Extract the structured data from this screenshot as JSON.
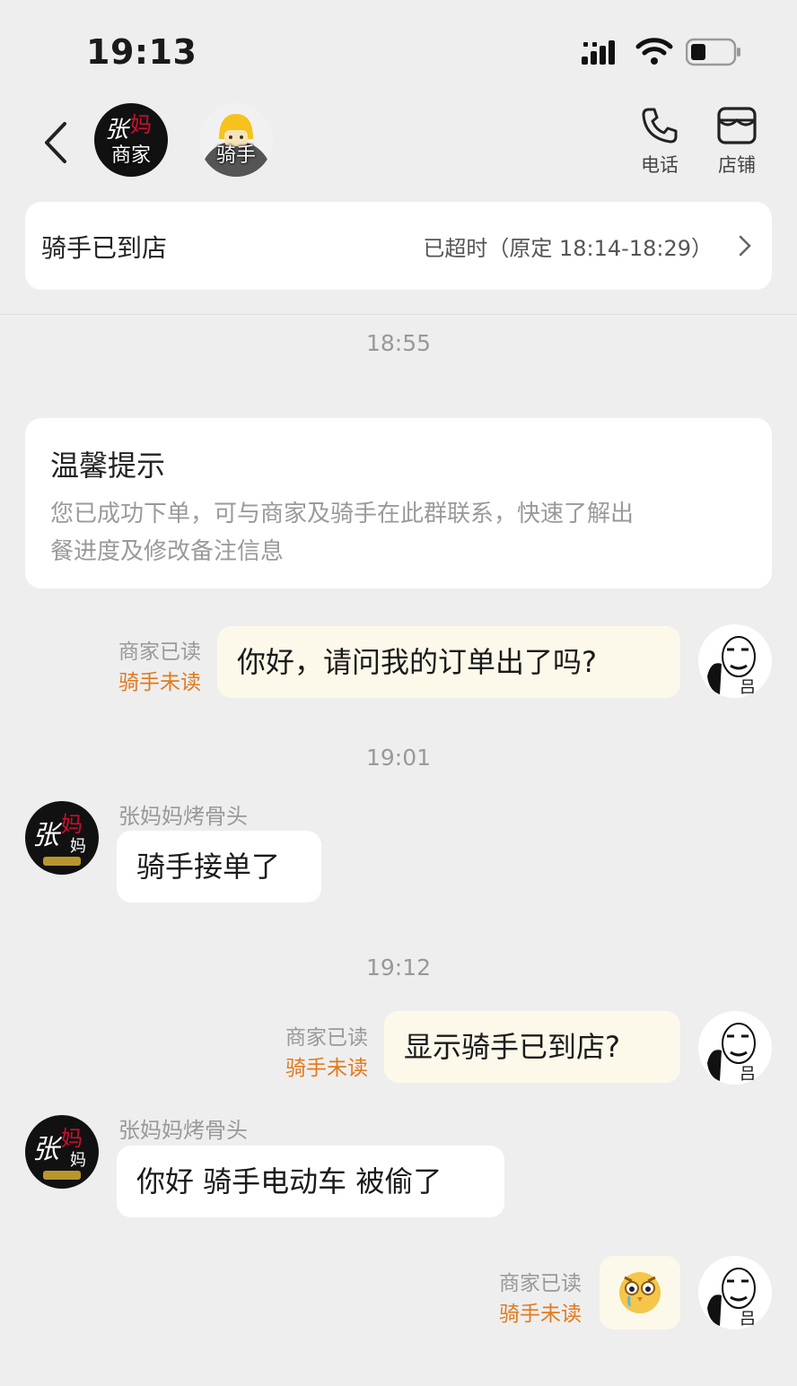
{
  "status_bar": {
    "time": "19:13"
  },
  "nav": {
    "merchant_avatar_label": "商家",
    "rider_avatar_label": "骑手",
    "actions": [
      {
        "label": "电话",
        "icon": "phone-icon"
      },
      {
        "label": "店铺",
        "icon": "store-icon"
      }
    ]
  },
  "order": {
    "title": "骑手已到店",
    "status": "已超时（原定 18:14-18:29）"
  },
  "tip": {
    "title": "温馨提示",
    "body_line1": "您已成功下单，可与商家及骑手在此群联系，快速了解出",
    "body_line2": "餐进度及修改备注信息"
  },
  "chat": {
    "timestamps": [
      "18:55",
      "19:01",
      "19:12"
    ],
    "merchant_name": "张妈妈烤骨头",
    "read_merchant": "商家已读",
    "unread_rider": "骑手未读",
    "messages": [
      {
        "from": "me",
        "text": "你好，请问我的订单出了吗?"
      },
      {
        "from": "merchant",
        "text": "骑手接单了"
      },
      {
        "from": "me",
        "text": "显示骑手已到店?"
      },
      {
        "from": "merchant",
        "text": "你好 骑手电动车 被偷了"
      },
      {
        "from": "me",
        "text": "",
        "emoji": "crying-owl-emoji"
      }
    ]
  },
  "colors": {
    "rider_unread": "#e07a1f",
    "outgoing_bubble": "#fdf9ea",
    "background": "#eeeeee"
  }
}
